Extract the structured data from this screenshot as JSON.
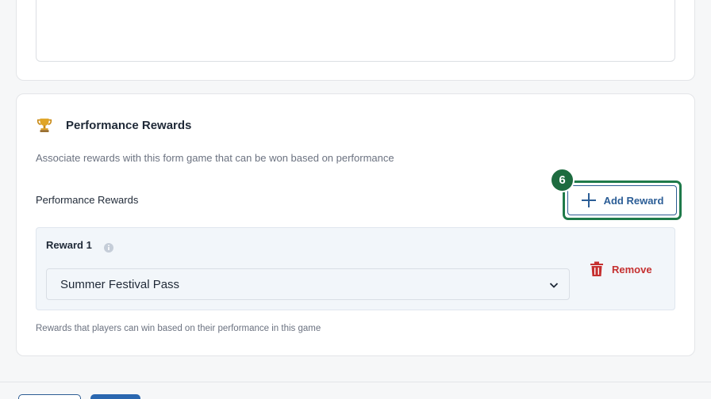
{
  "rewards_section": {
    "title": "Performance Rewards",
    "description": "Associate rewards with this form game that can be won based on performance",
    "field_label": "Performance Rewards",
    "add_button_label": "Add Reward",
    "step_badge": "6",
    "helper_text": "Rewards that players can win based on their performance in this game"
  },
  "rewards": [
    {
      "label": "Reward 1",
      "selected_value": "Summer Festival Pass",
      "remove_label": "Remove"
    }
  ],
  "icons": {
    "section": "trophy-icon",
    "add": "plus-icon",
    "info": "info-icon",
    "select": "chevron-down-icon",
    "remove": "trash-icon"
  },
  "colors": {
    "accent_blue": "#2b5d96",
    "highlight_green": "#1d6b3f",
    "danger_red": "#c53030",
    "trophy_gold": "#d99a1e"
  }
}
